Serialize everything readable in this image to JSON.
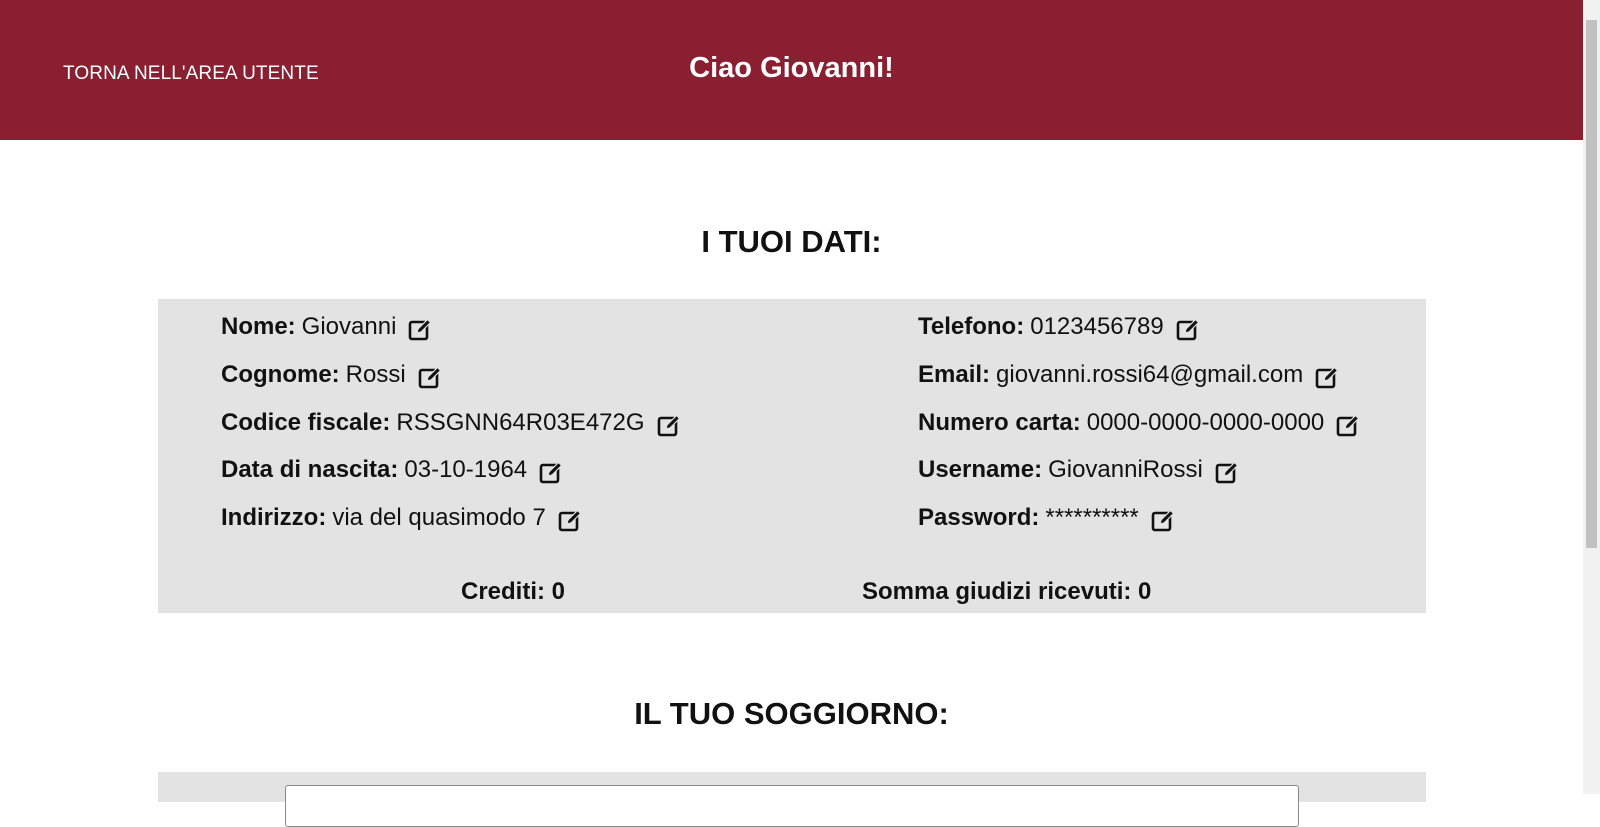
{
  "header": {
    "back_link": "TORNA NELL'AREA UTENTE",
    "greeting": "Ciao Giovanni!",
    "bg_color": "#891f31"
  },
  "dati": {
    "title": "I TUOI DATI:",
    "left": [
      {
        "label": "Nome:",
        "value": "Giovanni"
      },
      {
        "label": "Cognome:",
        "value": "Rossi"
      },
      {
        "label": "Codice fiscale:",
        "value": "RSSGNN64R03E472G"
      },
      {
        "label": "Data di nascita:",
        "value": "03-10-1964"
      },
      {
        "label": "Indirizzo:",
        "value": "via del quasimodo 7"
      }
    ],
    "right": [
      {
        "label": "Telefono:",
        "value": "0123456789"
      },
      {
        "label": "Email:",
        "value": "giovanni.rossi64@gmail.com"
      },
      {
        "label": "Numero carta:",
        "value": "0000-0000-0000-0000"
      },
      {
        "label": "Username:",
        "value": "GiovanniRossi"
      },
      {
        "label": "Password:",
        "value": "**********"
      }
    ],
    "crediti": "Crediti: 0",
    "giudizi": "Somma giudizi ricevuti: 0",
    "edit_icon": "edit-square-pencil-icon"
  },
  "soggiorno": {
    "title": "IL TUO SOGGIORNO:"
  }
}
